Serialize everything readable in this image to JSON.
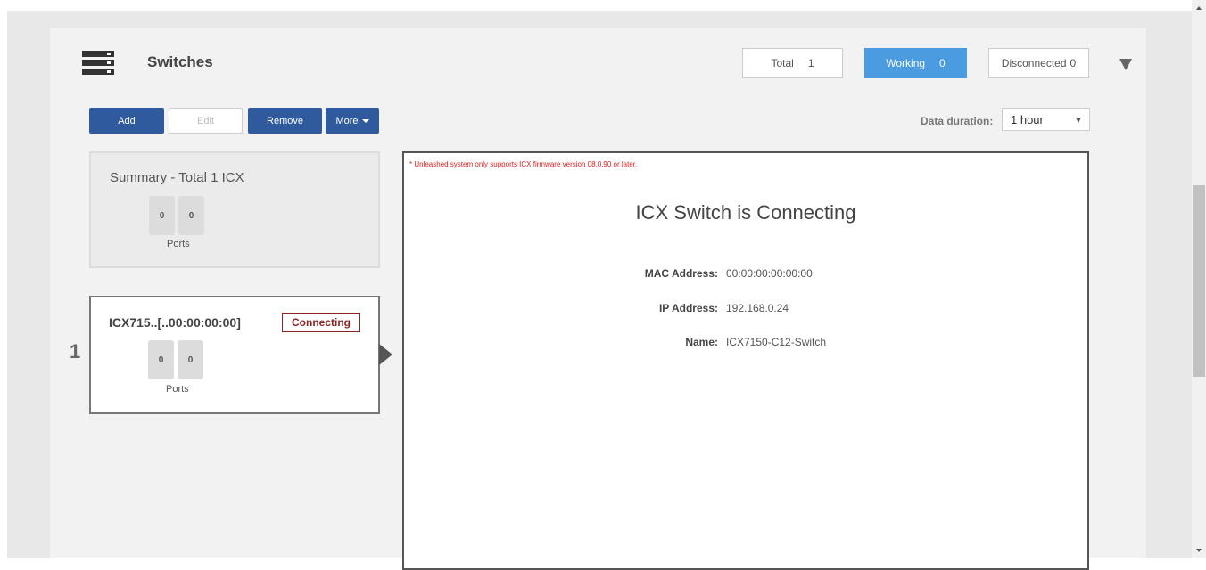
{
  "header": {
    "title": "Switches",
    "icon": "switch-stack-icon"
  },
  "stats": {
    "total": {
      "label": "Total",
      "value": "1"
    },
    "working": {
      "label": "Working",
      "value": "0"
    },
    "disconnected": {
      "label": "Disconnected",
      "value": "0"
    }
  },
  "toolbar": {
    "add_label": "Add",
    "edit_label": "Edit",
    "remove_label": "Remove",
    "more_label": "More"
  },
  "data_duration": {
    "label": "Data duration:",
    "selected": "1 hour"
  },
  "summary": {
    "title": "Summary - Total 1 ICX",
    "ports": [
      "0",
      "0"
    ],
    "ports_label": "Ports"
  },
  "switch_list": [
    {
      "index": "1",
      "name": "ICX715..[..00:00:00:00]",
      "status": "Connecting",
      "ports": [
        "0",
        "0"
      ],
      "ports_label": "Ports"
    }
  ],
  "details": {
    "notice": "* Unleashed system only supports ICX firmware version 08.0.90 or later.",
    "title": "ICX Switch is Connecting",
    "fields": [
      {
        "label": "MAC Address:",
        "value": "00:00:00:00:00:00"
      },
      {
        "label": "IP Address:",
        "value": "192.168.0.24"
      },
      {
        "label": "Name:",
        "value": "ICX7150-C12-Switch"
      }
    ]
  },
  "colors": {
    "primary_button": "#2f5b9e",
    "working_badge": "#4a9be0",
    "status_connecting": "#8b2323",
    "notice_text": "#e02020"
  }
}
